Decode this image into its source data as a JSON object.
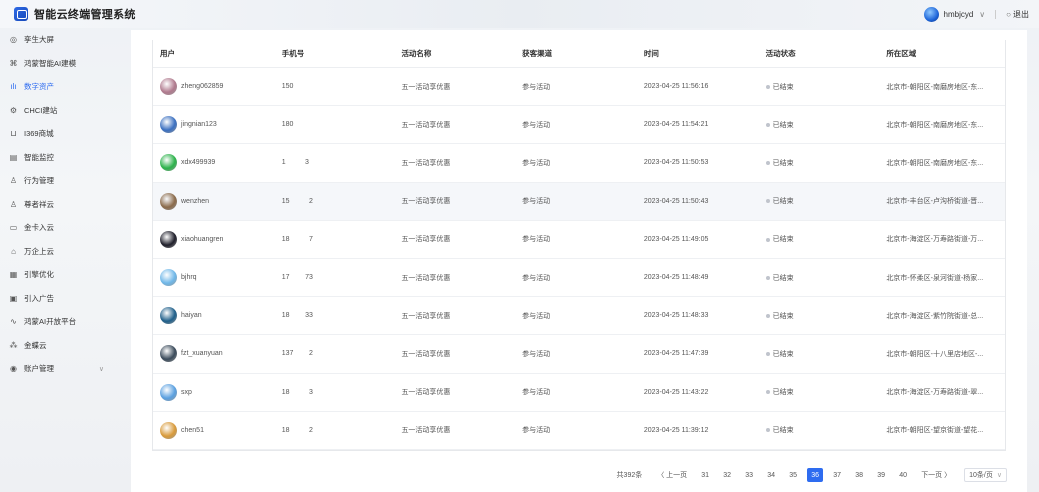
{
  "app": {
    "title": "智能云终端管理系统"
  },
  "user": {
    "name": "hmbjcyd",
    "logout": "退出"
  },
  "sidebar": {
    "items": [
      {
        "label": "孪生大屏",
        "icon": "dashboard-icon",
        "glyph": "◎"
      },
      {
        "label": "鸿蒙智能AI建模",
        "icon": "model-icon",
        "glyph": "⌘"
      },
      {
        "label": "数字资产",
        "icon": "chart-icon",
        "glyph": "ılı",
        "active": true
      },
      {
        "label": "CHCI建站",
        "icon": "gear-icon",
        "glyph": "⚙"
      },
      {
        "label": "I369商城",
        "icon": "cart-icon",
        "glyph": "⊔"
      },
      {
        "label": "智能监控",
        "icon": "monitor-icon",
        "glyph": "▤"
      },
      {
        "label": "行为管理",
        "icon": "user-icon",
        "glyph": "♙"
      },
      {
        "label": "尊者祥云",
        "icon": "person-icon",
        "glyph": "♙"
      },
      {
        "label": "金卡入云",
        "icon": "card-icon",
        "glyph": "▭"
      },
      {
        "label": "万企上云",
        "icon": "building-icon",
        "glyph": "⌂"
      },
      {
        "label": "引擎优化",
        "icon": "engine-icon",
        "glyph": "▦"
      },
      {
        "label": "引入广告",
        "icon": "ad-icon",
        "glyph": "▣"
      },
      {
        "label": "鸿蒙AI开放平台",
        "icon": "trend-icon",
        "glyph": "∿"
      },
      {
        "label": "金蝶云",
        "icon": "cloud-icon",
        "glyph": "⁂"
      },
      {
        "label": "账户管理",
        "icon": "account-icon",
        "glyph": "◉",
        "expandable": true
      }
    ]
  },
  "table": {
    "headers": [
      "用户",
      "手机号",
      "活动名称",
      "获客渠道",
      "时间",
      "活动状态",
      "所在区域"
    ],
    "rows": [
      {
        "user": "zheng062859",
        "avatar": "#b07a8e",
        "phone": "150",
        "activity": "五一活动享优惠",
        "channel": "参与活动",
        "time": "2023-04-25 11:56:16",
        "status": "已结束",
        "region": "北京市-朝阳区-南磨房地区-东..."
      },
      {
        "user": "jingnian123",
        "avatar": "#3a6fc0",
        "phone": "180",
        "activity": "五一活动享优惠",
        "channel": "参与活动",
        "time": "2023-04-25 11:54:21",
        "status": "已结束",
        "region": "北京市-朝阳区-南磨房地区-东..."
      },
      {
        "user": "xdx499939",
        "avatar": "#2bb24a",
        "phone": "1          3",
        "activity": "五一活动享优惠",
        "channel": "参与活动",
        "time": "2023-04-25 11:50:53",
        "status": "已结束",
        "region": "北京市-朝阳区-南磨房地区-东..."
      },
      {
        "user": "wenzhen",
        "avatar": "#8a6a4a",
        "phone": "15          2",
        "activity": "五一活动享优惠",
        "channel": "参与活动",
        "time": "2023-04-25 11:50:43",
        "status": "已结束",
        "region": "北京市-丰台区-卢沟桥街道-晋..."
      },
      {
        "user": "xiaohuangren",
        "avatar": "#1e1e2a",
        "phone": "18          7",
        "activity": "五一活动享优惠",
        "channel": "参与活动",
        "time": "2023-04-25 11:49:05",
        "status": "已结束",
        "region": "北京市-海淀区-万寿路街道-万..."
      },
      {
        "user": "bjhrq",
        "avatar": "#6fb7e8",
        "phone": "17        73",
        "activity": "五一活动享优惠",
        "channel": "参与活动",
        "time": "2023-04-25 11:48:49",
        "status": "已结束",
        "region": "北京市-怀柔区-泉河街道-杨家..."
      },
      {
        "user": "haiyan",
        "avatar": "#1f5f8a",
        "phone": "18        33",
        "activity": "五一活动享优惠",
        "channel": "参与活动",
        "time": "2023-04-25 11:48:33",
        "status": "已结束",
        "region": "北京市-海淀区-紫竹院街道-总..."
      },
      {
        "user": "fzt_xuanyuan",
        "avatar": "#3a4a5a",
        "phone": "137        2",
        "activity": "五一活动享优惠",
        "channel": "参与活动",
        "time": "2023-04-25 11:47:39",
        "status": "已结束",
        "region": "北京市-朝阳区-十八里店地区-..."
      },
      {
        "user": "sxp",
        "avatar": "#5aa0e0",
        "phone": "18          3",
        "activity": "五一活动享优惠",
        "channel": "参与活动",
        "time": "2023-04-25 11:43:22",
        "status": "已结束",
        "region": "北京市-海淀区-万寿路街道-翠..."
      },
      {
        "user": "chen51",
        "avatar": "#d89a3a",
        "phone": "18          2",
        "activity": "五一活动享优惠",
        "channel": "参与活动",
        "time": "2023-04-25 11:39:12",
        "status": "已结束",
        "region": "北京市-朝阳区-望京街道-望花..."
      }
    ]
  },
  "pagination": {
    "total": "共392条",
    "prev": "〈 上一页",
    "next": "下一页 〉",
    "pages": [
      "31",
      "32",
      "33",
      "34",
      "35",
      "36",
      "37",
      "38",
      "39",
      "40"
    ],
    "current": "36",
    "size": "10条/页"
  }
}
